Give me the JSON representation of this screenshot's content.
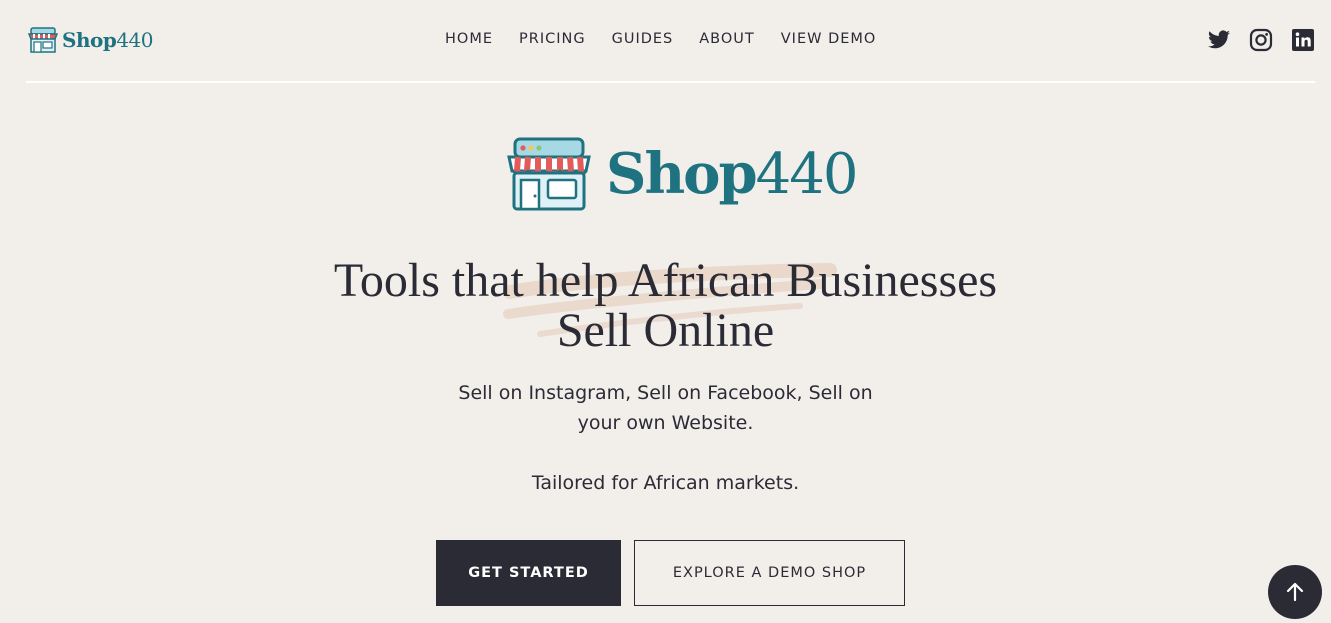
{
  "colors": {
    "background": "#f2efeb",
    "text": "#2b2b36",
    "brand_teal": "#1f7280",
    "accent_red": "#e25c5c",
    "brush": "#e9d5c8"
  },
  "header": {
    "logo": {
      "bold": "Shop",
      "light": "440",
      "icon": "storefront-icon"
    },
    "nav": [
      {
        "label": "HOME"
      },
      {
        "label": "PRICING"
      },
      {
        "label": "GUIDES"
      },
      {
        "label": "ABOUT"
      },
      {
        "label": "VIEW DEMO"
      }
    ],
    "social": [
      {
        "icon": "twitter-icon"
      },
      {
        "icon": "instagram-icon"
      },
      {
        "icon": "linkedin-icon"
      }
    ]
  },
  "hero": {
    "logo": {
      "bold": "Shop",
      "light": "440",
      "icon": "storefront-icon"
    },
    "headline_line1": "Tools that help African Businesses",
    "headline_line2": "Sell Online",
    "subtitle_line1": "Sell on Instagram, Sell on Facebook, Sell on",
    "subtitle_line2": "your own Website.",
    "tagline": "Tailored for African markets.",
    "primary_button": "GET STARTED",
    "secondary_button": "EXPLORE A DEMO SHOP"
  },
  "back_to_top": {
    "icon": "arrow-up-icon"
  }
}
